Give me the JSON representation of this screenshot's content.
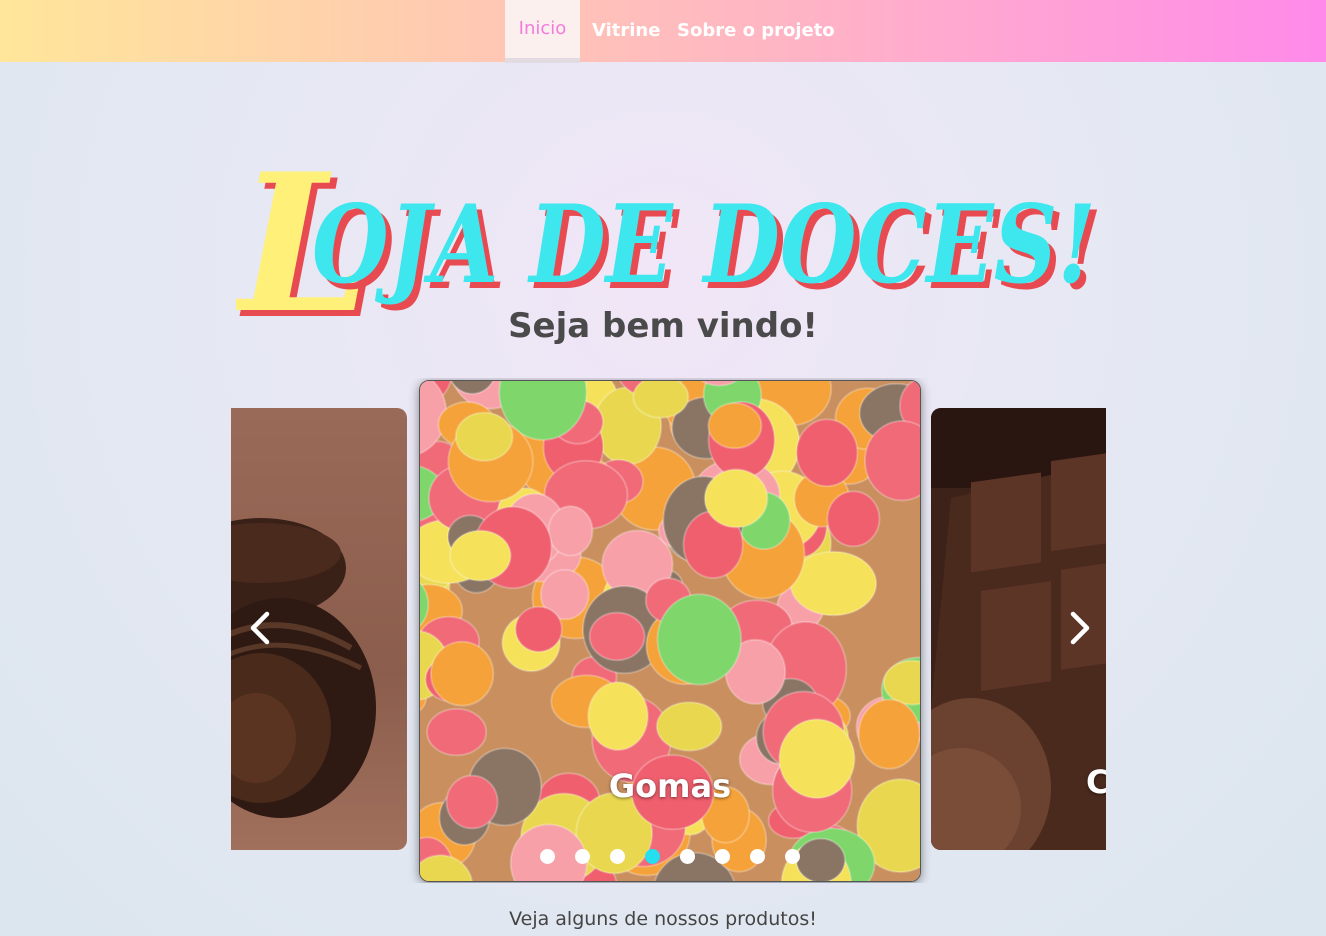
{
  "nav": {
    "items": [
      {
        "label": "Inicio",
        "active": true
      },
      {
        "label": "Vitrine",
        "active": false
      },
      {
        "label": "Sobre o projeto",
        "active": false
      }
    ]
  },
  "hero": {
    "title_initial": "L",
    "title_rest": "OJA DE DOCES!",
    "subtitle": "Seja bem vindo!"
  },
  "carousel": {
    "center_caption": "Gomas",
    "right_caption": "C",
    "dot_count": 8,
    "active_dot": 4,
    "prev_icon": "chevron-left-icon",
    "next_icon": "chevron-right-icon"
  },
  "footer": {
    "text": "Veja alguns de nossos produtos!"
  },
  "colors": {
    "title_cyan": "#3ee6ee",
    "title_yellow": "#fff07a",
    "title_shadow": "#e84a52",
    "active_nav": "#f37bdc",
    "active_dot": "#24dfef"
  }
}
